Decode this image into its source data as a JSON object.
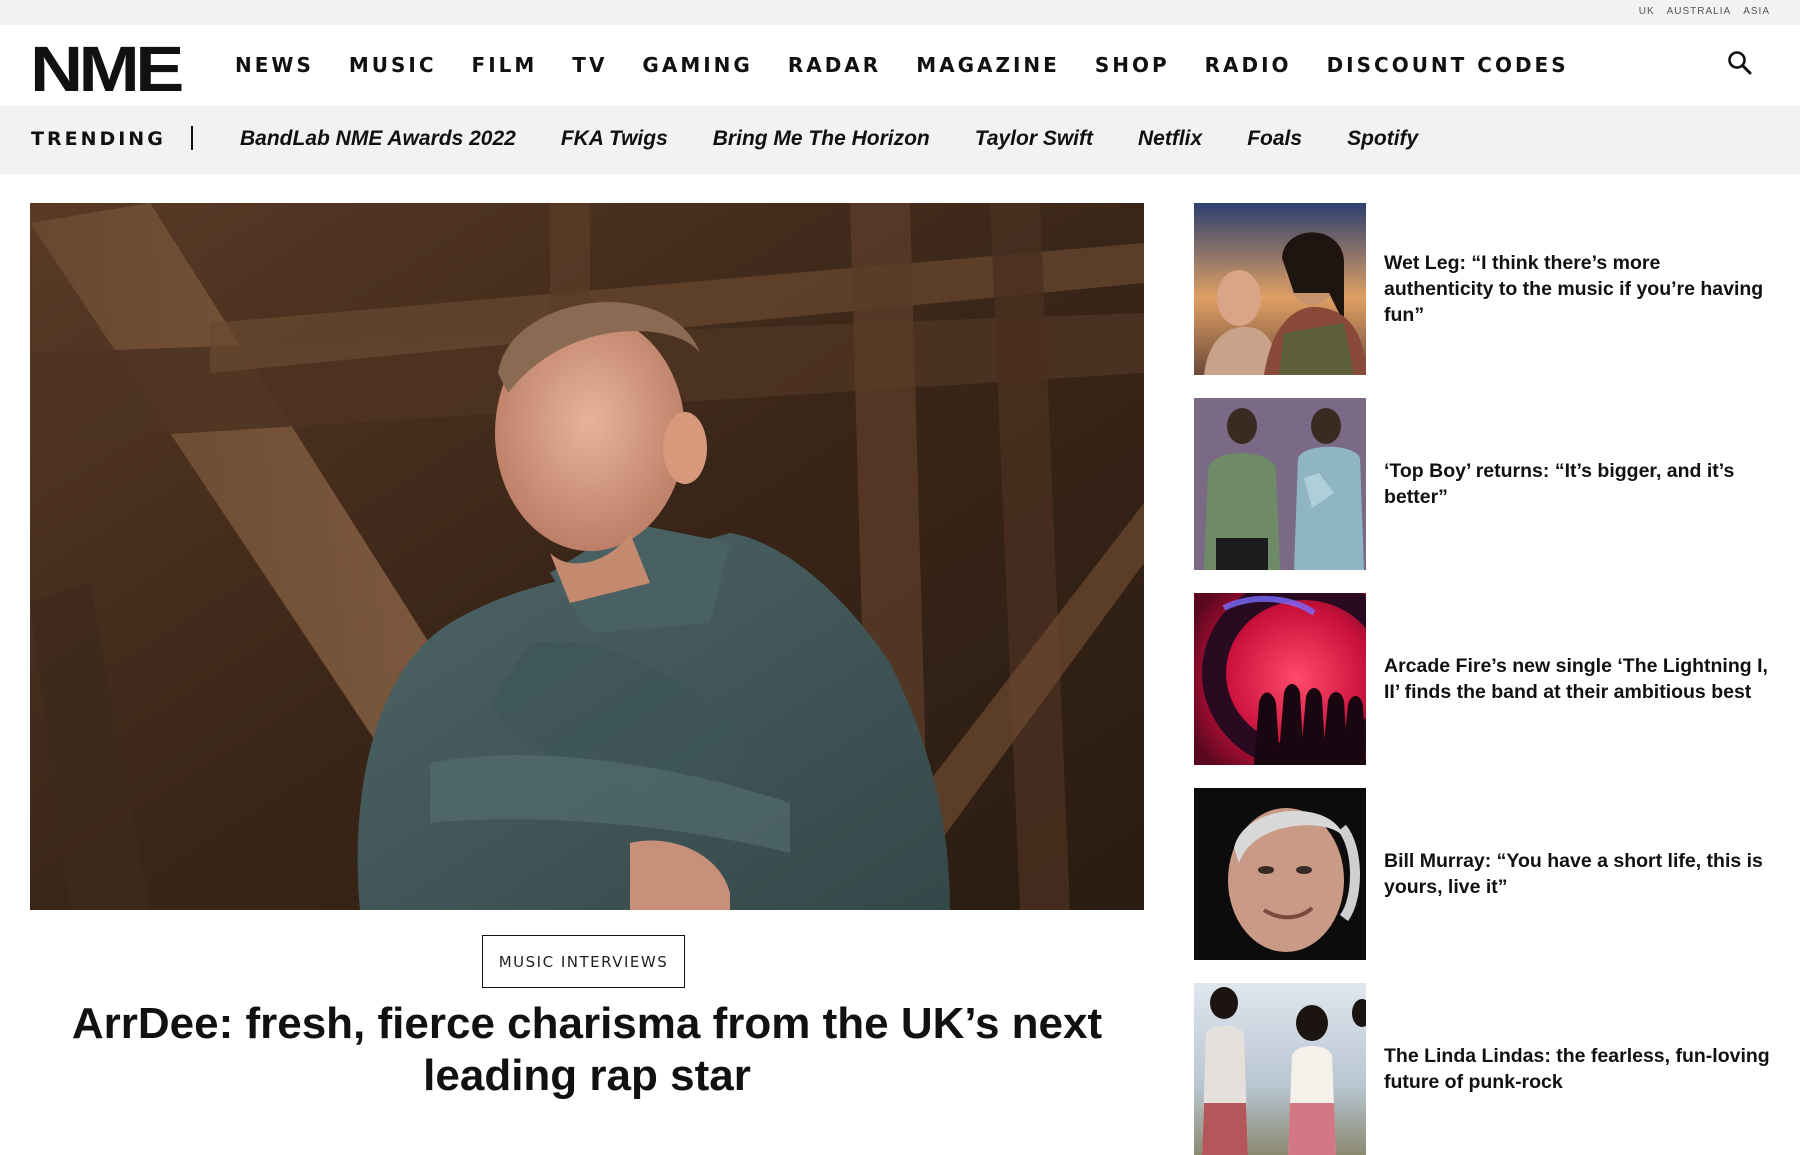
{
  "regions": [
    "UK",
    "AUSTRALIA",
    "ASIA"
  ],
  "brand": {
    "logo": "NME"
  },
  "nav": [
    "NEWS",
    "MUSIC",
    "FILM",
    "TV",
    "GAMING",
    "RADAR",
    "MAGAZINE",
    "SHOP",
    "RADIO",
    "DISCOUNT CODES"
  ],
  "trending": {
    "label": "TRENDING",
    "links": [
      "BandLab NME Awards 2022",
      "FKA Twigs",
      "Bring Me The Horizon",
      "Taylor Swift",
      "Netflix",
      "Foals",
      "Spotify"
    ]
  },
  "hero": {
    "category": "MUSIC INTERVIEWS",
    "title": "ArrDee: fresh, fierce charisma from the UK’s next leading rap star"
  },
  "sidebar": [
    {
      "title": "Wet Leg: “I think there’s more authenticity to the music if you’re having fun”"
    },
    {
      "title": "‘Top Boy’ returns: “It’s bigger, and it’s better”"
    },
    {
      "title": "Arcade Fire’s new single ‘The Lightning I, II’ finds the band at their ambitious best"
    },
    {
      "title": "Bill Murray: “You have a short life, this is yours, live it”"
    },
    {
      "title": "The Linda Lindas: the fearless, fun-loving future of punk-rock"
    }
  ],
  "icons": {
    "search": "search-icon"
  }
}
